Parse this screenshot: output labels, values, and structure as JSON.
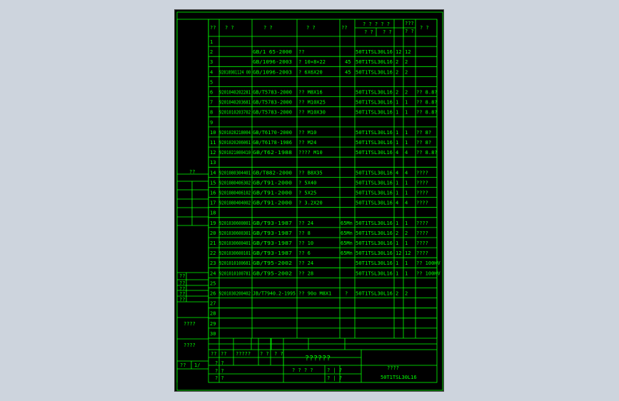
{
  "header": {
    "no": "??",
    "code": "? ?",
    "standard": "? ?",
    "name": "? ?",
    "qty_single": "??",
    "group": "? ? ? ? ?",
    "group_sub": "? ?",
    "group_sub2": "? ?",
    "total_a": "???",
    "total_b": "? ?",
    "remark": "? ?"
  },
  "rows": [
    {
      "n": "1",
      "code": "",
      "std": "",
      "name": "",
      "mat": "",
      "asm": "",
      "q1": "",
      "q2": "",
      "rem": ""
    },
    {
      "n": "2",
      "code": "",
      "std": "GB/1 65-2000",
      "name": "??",
      "mat": "",
      "asm": "50T1TSL30L16",
      "q1": "12",
      "q2": "12",
      "rem": ""
    },
    {
      "n": "3",
      "code": "",
      "std": "GB/1096-2003",
      "name": "? 10×8×22",
      "mat": "45",
      "asm": "50T1TSL30L16",
      "q1": "2",
      "q2": "2",
      "rem": ""
    },
    {
      "n": "4",
      "code": "92818981124 00",
      "std": "GB/1096-2003",
      "name": "? 6X6X20",
      "mat": "45",
      "asm": "50T1TSL30L16",
      "q1": "2",
      "q2": "2",
      "rem": ""
    },
    {
      "n": "5",
      "code": "",
      "std": "",
      "name": "",
      "mat": "",
      "asm": "",
      "q1": "",
      "q2": "",
      "rem": ""
    },
    {
      "n": "6",
      "code": "9201040202281",
      "std": "GB/T5783-2000",
      "name": "?? M8X16",
      "mat": "",
      "asm": "50T1TSL30L16",
      "q1": "2",
      "q2": "2",
      "rem": "?? 8.8?"
    },
    {
      "n": "7",
      "code": "9201040203681",
      "std": "GB/T5783-2000",
      "name": "?? M10X25",
      "mat": "",
      "asm": "50T1TSL30L16",
      "q1": "1",
      "q2": "1",
      "rem": "?? 8.8?"
    },
    {
      "n": "8",
      "code": "9201010203702",
      "std": "GB/T5783-2000",
      "name": "?? M10X30",
      "mat": "",
      "asm": "50T1TSL30L16",
      "q1": "1",
      "q2": "1",
      "rem": "?? 8.8?"
    },
    {
      "n": "9",
      "code": "",
      "std": "",
      "name": "",
      "mat": "",
      "asm": "",
      "q1": "",
      "q2": "",
      "rem": ""
    },
    {
      "n": "10",
      "code": "9201028218004",
      "std": "GB/T6170-2000",
      "name": "?? M10",
      "mat": "",
      "asm": "50T1TSL30L16",
      "q1": "1",
      "q2": "1",
      "rem": "?? 8?"
    },
    {
      "n": "11",
      "code": "9201020206061",
      "std": "GB/T6178-1986",
      "name": "?? M24",
      "mat": "",
      "asm": "50T1TSL30L16",
      "q1": "1",
      "q2": "1",
      "rem": "?? 8?"
    },
    {
      "n": "12",
      "code": "9201021800410",
      "std": "GB/T62-1988",
      "name": "???? M10",
      "mat": "",
      "asm": "50T1TSL30L16",
      "q1": "4",
      "q2": "4",
      "rem": "?? 8.8?"
    },
    {
      "n": "13",
      "code": "",
      "std": "",
      "name": "",
      "mat": "",
      "asm": "",
      "q1": "",
      "q2": "",
      "rem": ""
    },
    {
      "n": "14",
      "code": "9201080304401",
      "std": "GB/T882-2000",
      "name": "?? B8X35",
      "mat": "",
      "asm": "50T1TSL30L16",
      "q1": "4",
      "q2": "4",
      "rem": "????"
    },
    {
      "n": "15",
      "code": "9201080406302",
      "std": "GB/T91-2000",
      "name": "? 5X40",
      "mat": "",
      "asm": "50T1TSL30L16",
      "q1": "1",
      "q2": "1",
      "rem": "????"
    },
    {
      "n": "16",
      "code": "9201080406102",
      "std": "GB/T91-2000",
      "name": "? 5X25",
      "mat": "",
      "asm": "50T1TSL30L16",
      "q1": "1",
      "q2": "1",
      "rem": "????"
    },
    {
      "n": "17",
      "code": "9201080404002",
      "std": "GB/T91-2000",
      "name": "? 3.2X20",
      "mat": "",
      "asm": "50T1TSL30L16",
      "q1": "4",
      "q2": "4",
      "rem": "????"
    },
    {
      "n": "18",
      "code": "",
      "std": "",
      "name": "",
      "mat": "",
      "asm": "",
      "q1": "",
      "q2": "",
      "rem": ""
    },
    {
      "n": "19",
      "code": "9201030600801",
      "std": "GB/T93-1987",
      "name": "?? 24",
      "mat": "65Mn",
      "asm": "50T1TSL30L16",
      "q1": "1",
      "q2": "1",
      "rem": "????"
    },
    {
      "n": "20",
      "code": "9201030600301",
      "std": "GB/T93-1987",
      "name": "?? 8",
      "mat": "65Mn",
      "asm": "50T1TSL30L16",
      "q1": "2",
      "q2": "2",
      "rem": "????"
    },
    {
      "n": "21",
      "code": "9201030600401",
      "std": "GB/T93-1987",
      "name": "?? 10",
      "mat": "65Mn",
      "asm": "50T1TSL30L16",
      "q1": "1",
      "q2": "1",
      "rem": "????"
    },
    {
      "n": "22",
      "code": "9201030600101",
      "std": "GB/T93-1987",
      "name": "?? 6",
      "mat": "65Mn",
      "asm": "50T1TSL30L16",
      "q1": "12",
      "q2": "12",
      "rem": "????"
    },
    {
      "n": "23",
      "code": "9201010100681",
      "std": "GB/T95-2002",
      "name": "?? 24",
      "mat": "",
      "asm": "50T1TSL30L16",
      "q1": "1",
      "q2": "1",
      "rem": "?? 100HV"
    },
    {
      "n": "24",
      "code": "9201010100781",
      "std": "GB/T95-2002",
      "name": "?? 28",
      "mat": "",
      "asm": "50T1TSL30L16",
      "q1": "1",
      "q2": "1",
      "rem": "?? 100HV"
    },
    {
      "n": "25",
      "code": "",
      "std": "",
      "name": "",
      "mat": "",
      "asm": "",
      "q1": "",
      "q2": "",
      "rem": ""
    },
    {
      "n": "26",
      "code": "9201030200402",
      "std": "JB/T7940.2-1995",
      "name": "?? 90o M8X1",
      "mat": "?",
      "asm": "50T1TSL30L16",
      "q1": "2",
      "q2": "2",
      "rem": ""
    },
    {
      "n": "27",
      "code": "",
      "std": "",
      "name": "",
      "mat": "",
      "asm": "",
      "q1": "",
      "q2": "",
      "rem": ""
    },
    {
      "n": "28",
      "code": "",
      "std": "",
      "name": "",
      "mat": "",
      "asm": "",
      "q1": "",
      "q2": "",
      "rem": ""
    },
    {
      "n": "29",
      "code": "",
      "std": "",
      "name": "",
      "mat": "",
      "asm": "",
      "q1": "",
      "q2": "",
      "rem": ""
    },
    {
      "n": "30",
      "code": "",
      "std": "",
      "name": "",
      "mat": "",
      "asm": "",
      "q1": "",
      "q2": "",
      "rem": ""
    }
  ],
  "left_strip": {
    "label_top": "??",
    "sign_rows": [
      "??",
      "??",
      "??",
      "??",
      "??"
    ],
    "sign_label": "????",
    "date_label": "????",
    "bottom_a": "??",
    "bottom_b": "1/"
  },
  "title_block": {
    "r1c1": "??",
    "r1c2": "??",
    "r1c3": "?????",
    "r1c4": "? ?",
    "r1c5": "? ?",
    "r2c1": "? ?",
    "r3c1": "? ?",
    "r4c1": "? ?",
    "title": "??????",
    "scale_label": "? ? ? ?",
    "sheet_a": "? | ?",
    "sheet_b": "? | ?",
    "company": "????",
    "drawing_no": "50T1TSL30L16"
  }
}
